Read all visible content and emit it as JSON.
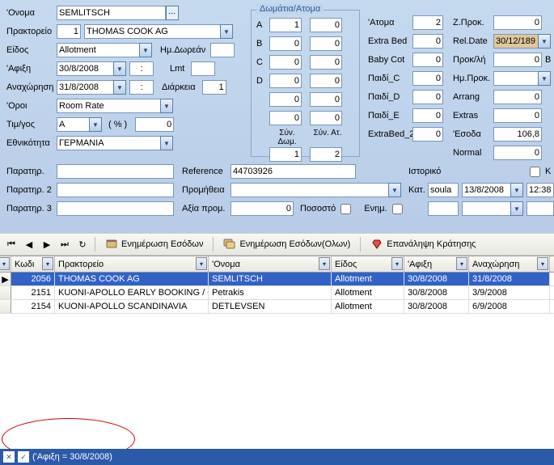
{
  "labels": {
    "onoma": "'Ονομα",
    "praktoreio": "Πρακτορείο",
    "eidos": "Είδος",
    "afiksi": "'Αφιξη",
    "anaxorisi": "Αναχώρηση",
    "oroi": "'Οροι",
    "timgos": "Τιμ/γος",
    "ethnikotita": "Εθνικότητα",
    "paratir": "Παρατηρ.",
    "paratir2": "Παρατηρ. 2",
    "paratir3": "Παρατηρ. 3",
    "hmdorean": "Ημ.Δωρεάν",
    "lmt": "Lmt",
    "diarkeia": "Διάρκεια",
    "pct": "( % )",
    "reference": "Reference",
    "promitheia": "Προμήθεια",
    "aksia_prom": "Αξία προμ.",
    "pososto": "Ποσοστό",
    "enim": "Ενημ.",
    "domatia_atoma": "Δωμάτια/Ατομα",
    "rowA": "A",
    "rowB": "B",
    "rowC": "C",
    "rowD": "D",
    "syndom": "Σύν. Δωμ.",
    "synat": "Σύν. Ατ.",
    "atoma": "'Ατομα",
    "extrabed": "Extra Bed",
    "babycot": "Baby Cot",
    "paidi_c": "Παιδί_C",
    "paidi_d": "Παιδί_D",
    "paidi_e": "Παιδί_E",
    "extrabed2": "ExtraBed_2",
    "zprok": "Ζ.Προκ.",
    "reldate": "Rel.Date",
    "prokli": "Προκ/λή",
    "hmprok": "Ημ.Προκ.",
    "arrang": "Arrang",
    "extras": "Extras",
    "esoda": "'Εσοδα",
    "normal": "Normal",
    "istoriko": "Ιστορικό",
    "kat": "Κατ.",
    "k_col": "K"
  },
  "form": {
    "onoma": "SEMLITSCH",
    "praktoreio_code": "1",
    "praktoreio_name": "THOMAS COOK AG",
    "eidos": "Allotment",
    "afiksi": "30/8/2008",
    "afiksi_time": ":",
    "lmt": "",
    "anaxorisi": "31/8/2008",
    "anaxorisi_time": ":",
    "diarkeia": "1",
    "oroi": "Room Rate",
    "timgos": "A",
    "timgos_pct": "0",
    "ethnikotita": "ΓΕΡΜΑΝΙΑ",
    "reference": "44703926",
    "aksia_prom": "0",
    "A1": "1",
    "A2": "0",
    "B1": "0",
    "B2": "0",
    "C1": "0",
    "C2": "0",
    "D1": "0",
    "D2": "0",
    "E1": "0",
    "E2": "0",
    "F1": "0",
    "F2": "0",
    "syndom": "1",
    "synat": "2",
    "atoma": "2",
    "extrabed": "0",
    "babycot": "0",
    "paidi_c": "0",
    "paidi_d": "0",
    "paidi_e": "0",
    "extrabed2": "0",
    "zprok": "0",
    "reldate": "30/12/189",
    "prokli": "0",
    "hmprok": "",
    "arrang": "0",
    "extras": "0",
    "esoda": "106,8",
    "normal": "0",
    "kat": "soula",
    "kat_date": "13/8/2008",
    "kat_time": "12:38"
  },
  "toolbar": {
    "enim_esodon": "Ενημέρωση Εσόδων",
    "enim_esodon_olon": "Ενημέρωση Εσόδων(Ολων)",
    "epanal_kratisis": "Επανάληψη Κράτησης"
  },
  "grid": {
    "headers": {
      "kodi": "Κωδι",
      "praktoreio": "Πρακτορείο",
      "onoma": "'Ονομα",
      "eidos": "Είδος",
      "afiksi": "'Αφιξη",
      "anaxorisi": "Αναχώρηση"
    },
    "rows": [
      {
        "kodi": "2056",
        "praktoreio": "THOMAS COOK AG",
        "onoma": "SEMLITSCH",
        "eidos": "Allotment",
        "afiksi": "30/8/2008",
        "anaxorisi": "31/8/2008",
        "sel": true
      },
      {
        "kodi": "2151",
        "praktoreio": "KUONI-APOLLO EARLY BOOKING / O",
        "onoma": "Petrakis",
        "eidos": "Allotment",
        "afiksi": "30/8/2008",
        "anaxorisi": "3/9/2008",
        "sel": false
      },
      {
        "kodi": "2154",
        "praktoreio": "KUONI-APOLLO SCANDINAVIA",
        "onoma": "DETLEVSEN",
        "eidos": "Allotment",
        "afiksi": "30/8/2008",
        "anaxorisi": "6/9/2008",
        "sel": false
      }
    ]
  },
  "status": "('Αφιξη = 30/8/2008)"
}
